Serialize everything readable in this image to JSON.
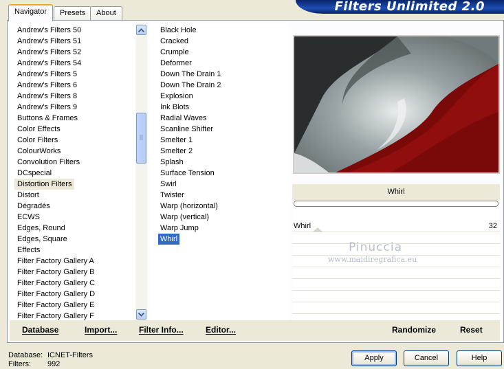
{
  "tabs": [
    {
      "label": "Navigator",
      "active": true
    },
    {
      "label": "Presets",
      "active": false
    },
    {
      "label": "About",
      "active": false
    }
  ],
  "banner": {
    "title": "Filters Unlimited 2.0"
  },
  "categories": {
    "items": [
      "Andrew's Filters 50",
      "Andrew's Filters 51",
      "Andrew's Filters 52",
      "Andrew's Filters 54",
      "Andrew's Filters 5",
      "Andrew's Filters 6",
      "Andrew's Filters 8",
      "Andrew's Filters 9",
      "Buttons & Frames",
      "Color Effects",
      "Color Filters",
      "ColourWorks",
      "Convolution Filters",
      "DCspecial",
      "Distortion Filters",
      "Distort",
      "Dégradés",
      "ECWS",
      "Edges, Round",
      "Edges, Square",
      "Effects",
      "Filter Factory Gallery A",
      "Filter Factory Gallery B",
      "Filter Factory Gallery C",
      "Filter Factory Gallery D",
      "Filter Factory Gallery E",
      "Filter Factory Gallery F"
    ],
    "selected": "Distortion Filters"
  },
  "filters": {
    "items": [
      "Black Hole",
      "Cracked",
      "Crumple",
      "Deformer",
      "Down The Drain 1",
      "Down The Drain 2",
      "Explosion",
      "Ink Blots",
      "Radial Waves",
      "Scanline Shifter",
      "Smelter 1",
      "Smelter 2",
      "Splash",
      "Surface Tension",
      "Swirl",
      "Twister",
      "Warp (horizontal)",
      "Warp (vertical)",
      "Warp Jump",
      "Whirl"
    ],
    "selected": "Whirl"
  },
  "bottom_buttons": {
    "database": "Database",
    "import": "Import...",
    "filter_info": "Filter Info...",
    "editor": "Editor...",
    "randomize": "Randomize",
    "reset": "Reset"
  },
  "preview": {
    "filter_name": "Whirl"
  },
  "controls": [
    {
      "label": "Whirl",
      "value": "32"
    }
  ],
  "watermark": {
    "line1": "Pinuccia",
    "line2": "www.maidiregrafica.eu"
  },
  "status": {
    "database_label": "Database:",
    "database_value": "ICNET-Filters",
    "filters_label": "Filters:",
    "filters_value": "992"
  },
  "dialog_buttons": {
    "apply": "Apply",
    "cancel": "Cancel",
    "help": "Help"
  },
  "colors": {
    "accent": "#316ac5",
    "banner": "#0a246a",
    "dark_red": "#7a0a0a"
  }
}
